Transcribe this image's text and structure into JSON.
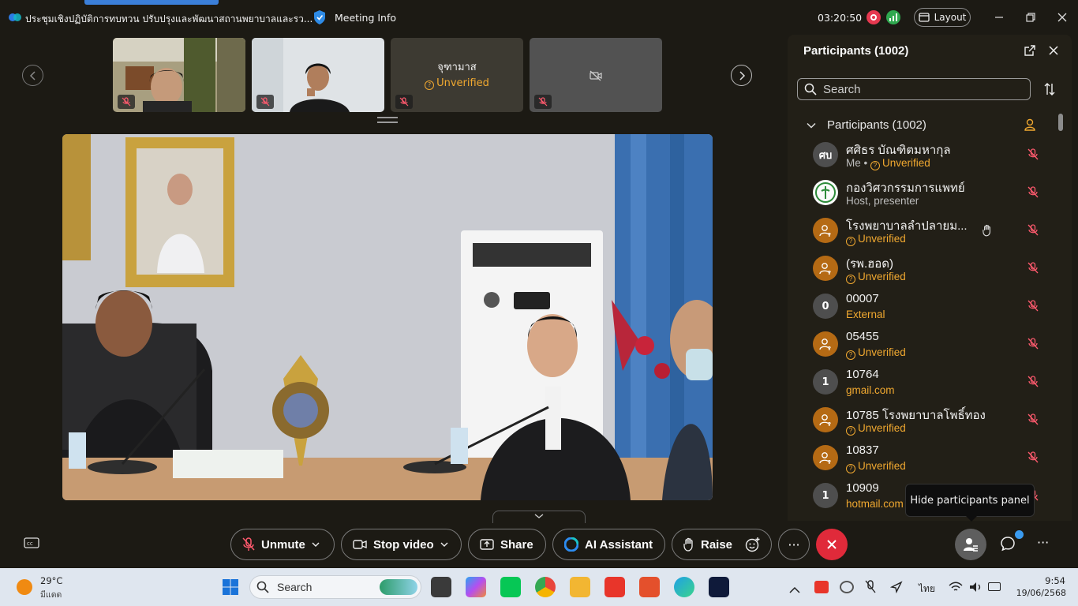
{
  "titlebar": {
    "meeting_title": "ประชุมเชิงปฏิบัติการทบทวน ปรับปรุงและพัฒนาสถานพยาบาลและรว...",
    "meeting_info": "Meeting Info",
    "timer": "03:20:50",
    "layout_label": "Layout"
  },
  "thumbnails": [
    {
      "name": "",
      "unverified": "",
      "muted": true,
      "video": true
    },
    {
      "name": "",
      "unverified": "",
      "muted": true,
      "video": true
    },
    {
      "name": "จุฑามาส",
      "unverified": "Unverified",
      "muted": true,
      "video": false
    },
    {
      "name": "",
      "unverified": "",
      "muted": true,
      "video": false
    }
  ],
  "toolbar": {
    "unmute": "Unmute",
    "stop_video": "Stop video",
    "share": "Share",
    "ai_assistant": "AI Assistant",
    "raise": "Raise",
    "more": "···",
    "overflow": "···"
  },
  "tooltip": "Hide participants panel",
  "panel": {
    "title": "Participants (1002)",
    "search_placeholder": "Search",
    "section_label": "Participants (1002)",
    "participants": [
      {
        "initials": "ศบ",
        "avatar": "gray",
        "name": "ศศิธร บัณฑิตมหากุล",
        "sub_prefix": "Me • ",
        "sub": "Unverified",
        "sub_color": "orange",
        "hand": false
      },
      {
        "initials": "",
        "avatar": "white",
        "name": "กองวิศวกรรมการแพทย์",
        "sub_prefix": "",
        "sub": "Host, presenter",
        "sub_color": "gray",
        "hand": false
      },
      {
        "initials": "",
        "avatar": "orange",
        "name": "โรงพยาบาลลำปลายม...",
        "sub_prefix": "",
        "sub": "Unverified",
        "sub_color": "orange",
        "hand": true
      },
      {
        "initials": "",
        "avatar": "orange",
        "name": "(รพ.ฮอด)",
        "sub_prefix": "",
        "sub": "Unverified",
        "sub_color": "orange",
        "hand": false
      },
      {
        "initials": "0",
        "avatar": "gray",
        "name": "00007",
        "sub_prefix": "",
        "sub": "External",
        "sub_color": "orange",
        "hand": false
      },
      {
        "initials": "",
        "avatar": "orange",
        "name": "05455",
        "sub_prefix": "",
        "sub": "Unverified",
        "sub_color": "orange",
        "hand": false
      },
      {
        "initials": "1",
        "avatar": "gray",
        "name": "10764",
        "sub_prefix": "",
        "sub": "gmail.com",
        "sub_color": "orange",
        "hand": false
      },
      {
        "initials": "",
        "avatar": "orange",
        "name": "10785 โรงพยาบาลโพธิ์ทอง",
        "sub_prefix": "",
        "sub": "Unverified",
        "sub_color": "orange",
        "hand": false
      },
      {
        "initials": "",
        "avatar": "orange",
        "name": "10837",
        "sub_prefix": "",
        "sub": "Unverified",
        "sub_color": "orange",
        "hand": false
      },
      {
        "initials": "1",
        "avatar": "gray",
        "name": "10909",
        "sub_prefix": "",
        "sub": "hotmail.com",
        "sub_color": "orange",
        "hand": false
      }
    ]
  },
  "taskbar": {
    "temperature": "29°C",
    "condition": "มีแดด",
    "search_label": "Search",
    "language": "ไทย",
    "time": "9:54",
    "date": "19/06/2568"
  },
  "colors": {
    "background": "#1c1a14",
    "panel": "#221f17",
    "unverified": "#f0a830",
    "leave": "#e02a3a",
    "record": "#e63950",
    "accent": "#3b7fd9"
  },
  "icons": [
    "webex-app-icon",
    "shield-icon",
    "record-icon",
    "signal-icon",
    "layout-icon",
    "minimize-icon",
    "restore-icon",
    "close-icon",
    "mic-muted-icon",
    "video-off-icon",
    "chevron-left-icon",
    "chevron-right-icon",
    "caption-icon",
    "camera-icon",
    "share-screen-icon",
    "ai-icon",
    "hand-icon",
    "emoji-icon",
    "x-icon",
    "participants-icon",
    "chat-icon",
    "popout-icon",
    "search-icon",
    "sort-icon",
    "chevron-down-icon",
    "moderator-icon"
  ]
}
